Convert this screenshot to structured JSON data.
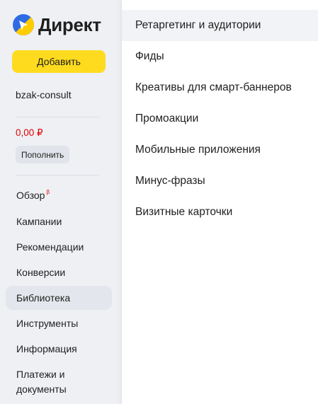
{
  "app": {
    "name": "Директ"
  },
  "sidebar": {
    "add_button": "Добавить",
    "account": "bzak-consult",
    "balance": "0,00 ₽",
    "topup_button": "Пополнить",
    "nav": [
      {
        "label": "Обзор",
        "badge": "β"
      },
      {
        "label": "Кампании"
      },
      {
        "label": "Рекомендации"
      },
      {
        "label": "Конверсии"
      },
      {
        "label": "Библиотека",
        "active": true
      },
      {
        "label": "Инструменты"
      },
      {
        "label": "Информация"
      },
      {
        "label": "Платежи и документы"
      }
    ]
  },
  "submenu": {
    "items": [
      {
        "label": "Ретаргетинг и аудитории",
        "active": true
      },
      {
        "label": "Фиды"
      },
      {
        "label": "Креативы для смарт-баннеров"
      },
      {
        "label": "Промоакции"
      },
      {
        "label": "Мобильные приложения"
      },
      {
        "label": "Минус-фразы"
      },
      {
        "label": "Визитные карточки"
      }
    ]
  },
  "colors": {
    "accent_yellow": "#ffdb1f",
    "logo_blue": "#2f6be5",
    "balance_red": "#e00000"
  }
}
